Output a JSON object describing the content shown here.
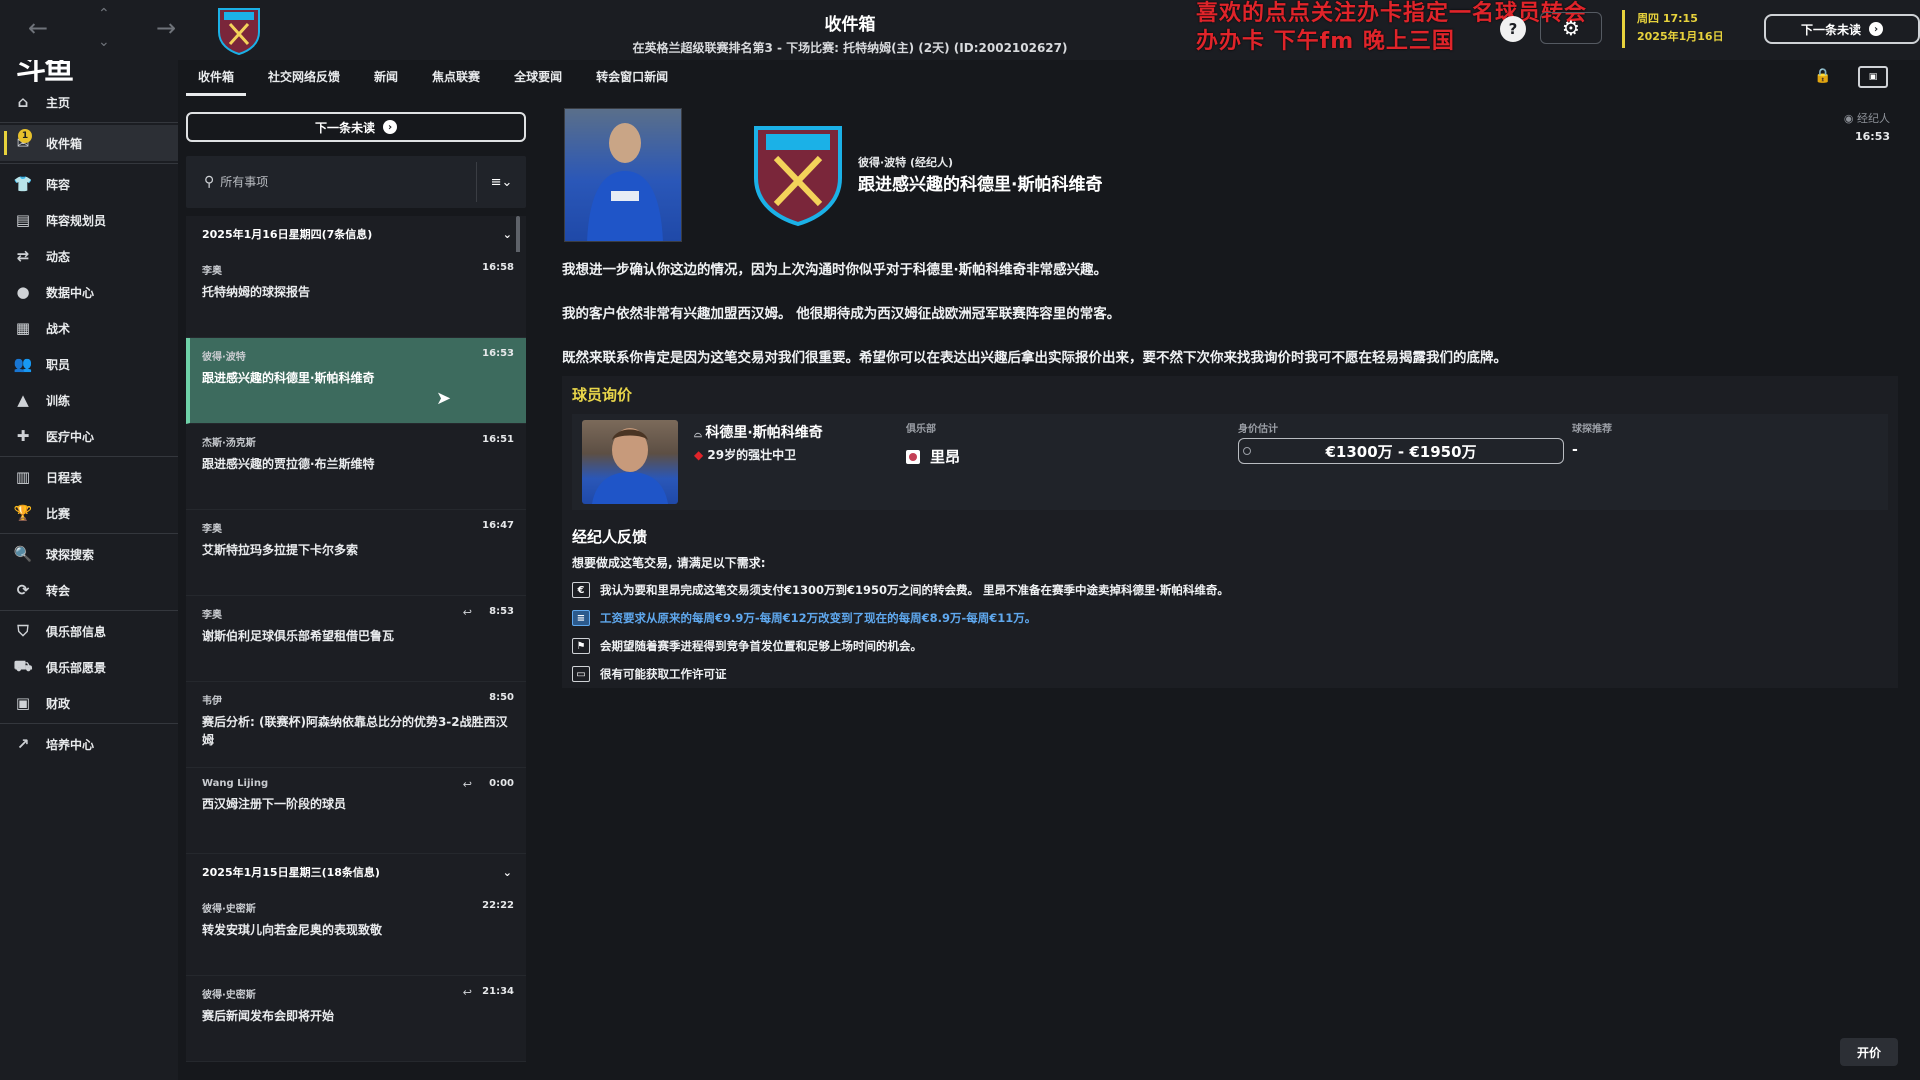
{
  "header": {
    "title": "收件箱",
    "subtitle": "在英格兰超级联赛排名第3 - 下场比赛: 托特纳姆(主) (2天) (ID:2002102627)",
    "overlay_line1": "喜欢的点点关注办卡指定一名球员转会",
    "overlay_line2": "办办卡  下午fm  晚上三国",
    "date_weekday_time": "周四 17:15",
    "date_full": "2025年1月16日",
    "next_unread": "下一条未读"
  },
  "sidebar": {
    "logo": "斗鱼",
    "items": [
      {
        "label": "主页",
        "icon": "home-icon"
      },
      {
        "label": "收件箱",
        "icon": "inbox-icon",
        "badge": "1"
      },
      {
        "label": "阵容",
        "icon": "squad-icon"
      },
      {
        "label": "阵容规划员",
        "icon": "planner-icon"
      },
      {
        "label": "动态",
        "icon": "dynamics-icon"
      },
      {
        "label": "数据中心",
        "icon": "data-hub-icon"
      },
      {
        "label": "战术",
        "icon": "tactics-icon"
      },
      {
        "label": "职员",
        "icon": "staff-icon"
      },
      {
        "label": "训练",
        "icon": "training-icon"
      },
      {
        "label": "医疗中心",
        "icon": "medical-icon"
      },
      {
        "label": "日程表",
        "icon": "schedule-icon"
      },
      {
        "label": "比赛",
        "icon": "trophy-icon"
      },
      {
        "label": "球探搜索",
        "icon": "scouting-icon"
      },
      {
        "label": "转会",
        "icon": "transfers-icon"
      },
      {
        "label": "俱乐部信息",
        "icon": "club-info-icon"
      },
      {
        "label": "俱乐部愿景",
        "icon": "club-vision-icon"
      },
      {
        "label": "财政",
        "icon": "finance-icon"
      },
      {
        "label": "培养中心",
        "icon": "development-icon"
      }
    ]
  },
  "tabs": [
    "收件箱",
    "社交网络反馈",
    "新闻",
    "焦点联赛",
    "全球要闻",
    "转会窗口新闻"
  ],
  "list": {
    "next_unread": "下一条未读",
    "search_placeholder": "所有事项",
    "day1_header": "2025年1月16日星期四(7条信息)",
    "day2_header": "2025年1月15日星期三(18条信息)",
    "day1": [
      {
        "sender": "李奥",
        "time": "16:58",
        "subject": "托特纳姆的球探报告",
        "replied": false
      },
      {
        "sender": "彼得·波特",
        "time": "16:53",
        "subject": "跟进感兴趣的科德里·斯帕科维奇",
        "replied": false
      },
      {
        "sender": "杰斯·汤克斯",
        "time": "16:51",
        "subject": "跟进感兴趣的贾拉德·布兰斯维特",
        "replied": false
      },
      {
        "sender": "李奥",
        "time": "16:47",
        "subject": "艾斯特拉玛多拉提下卡尔多索",
        "replied": false
      },
      {
        "sender": "李奥",
        "time": "8:53",
        "subject": "谢斯伯利足球俱乐部希望租借巴鲁瓦",
        "replied": true
      },
      {
        "sender": "韦伊",
        "time": "8:50",
        "subject": "赛后分析: (联赛杯)阿森纳依靠总比分的优势3-2战胜西汉姆",
        "replied": false
      },
      {
        "sender": "Wang Lijing",
        "time": "0:00",
        "subject": "西汉姆注册下一阶段的球员",
        "replied": true
      }
    ],
    "day2": [
      {
        "sender": "彼得·史密斯",
        "time": "22:22",
        "subject": "转发安琪儿向若金尼奥的表现致敬",
        "replied": false
      },
      {
        "sender": "彼得·史密斯",
        "time": "21:34",
        "subject": "赛后新闻发布会即将开始",
        "replied": true
      }
    ]
  },
  "detail": {
    "agent_tag": "经纪人",
    "time": "16:53",
    "sender": "彼得·波特 (经纪人)",
    "subject": "跟进感兴趣的科德里·斯帕科维奇",
    "para1": "我想进一步确认你这边的情况，因为上次沟通时你似乎对于科德里·斯帕科维奇非常感兴趣。",
    "para2": "我的客户依然非常有兴趣加盟西汉姆。 他很期待成为西汉姆征战欧洲冠军联赛阵容里的常客。",
    "para3": "既然来联系你肯定是因为这笔交易对我们很重要。希望你可以在表达出兴趣后拿出实际报价出来，要不然下次你来找我询价时我可不愿在轻易揭露我们的底牌。",
    "card_title": "球员询价",
    "player_name": "科德里·斯帕科维奇",
    "player_desc": "29岁的强壮中卫",
    "col_club": "俱乐部",
    "club_value": "里昂",
    "col_value": "身价估计",
    "value_range": "€1300万 - €1950万",
    "col_scout": "球探推荐",
    "scout_value": "-",
    "feedback_title": "经纪人反馈",
    "feedback_intro": "想要做成这笔交易, 请满足以下需求:",
    "req1": "我认为要和里昂完成这笔交易须支付€1300万到€1950万之间的转会费。 里昂不准备在赛季中途卖掉科德里·斯帕科维奇。",
    "req2": "工资要求从原来的每周€9.9万-每周€12万改变到了现在的每周€8.9万-每周€11万。",
    "req3": "会期望随着赛季进程得到竞争首发位置和足够上场时间的机会。",
    "req4": "很有可能获取工作许可证",
    "offer_button": "开价"
  },
  "colors": {
    "accent_yellow": "#e7d23c",
    "selected_row": "#3d6b5e",
    "link_blue": "#5fa8ee",
    "overlay_red": "#e0242a"
  }
}
